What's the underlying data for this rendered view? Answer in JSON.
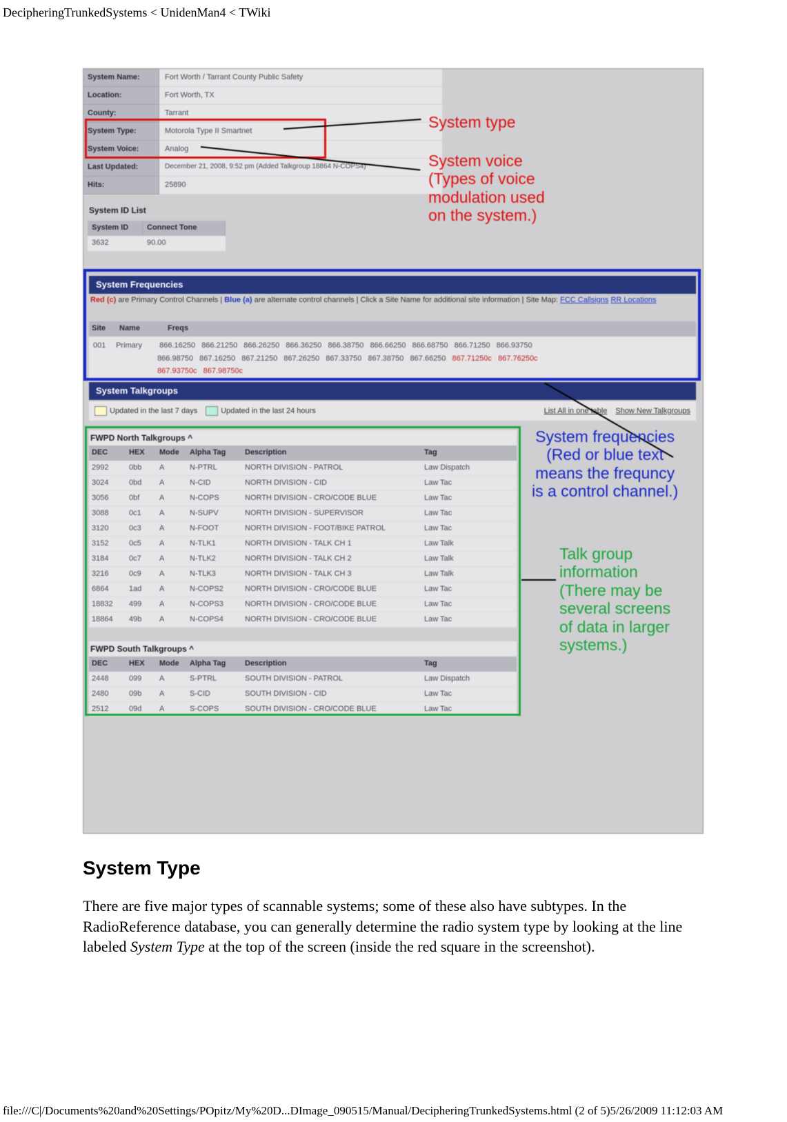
{
  "header": {
    "path": "DecipheringTrunkedSystems < UnidenMan4 < TWiki"
  },
  "info": {
    "rows": [
      {
        "label": "System Name:",
        "val": "Fort Worth / Tarrant County Public Safety"
      },
      {
        "label": "Location:",
        "val": "Fort Worth, TX"
      },
      {
        "label": "County:",
        "val": "Tarrant"
      },
      {
        "label": "System Type:",
        "val": "Motorola Type II Smartnet"
      },
      {
        "label": "System Voice:",
        "val": "Analog"
      },
      {
        "label": "Last Updated:",
        "val": "December 21, 2008, 9:52 pm (Added Talkgroup 18864 N-COPS4)"
      },
      {
        "label": "Hits:",
        "val": "25890"
      }
    ]
  },
  "sysid": {
    "title": "System ID List",
    "hdr_id": "System ID",
    "hdr_ct": "Connect Tone",
    "row_id": "3632",
    "row_ct": "90.00"
  },
  "sections": {
    "freq": "System Frequencies",
    "tg": "System Talkgroups"
  },
  "freqnote": {
    "red_label": "Red (c)",
    "text1": " are Primary Control Channels | ",
    "blue_label": "Blue (a)",
    "text2": " are alternate control channels | Click a Site Name for additional site information | Site Map: ",
    "link1": "FCC Callsigns",
    "sep": " ",
    "link2": "RR Locations"
  },
  "freqhdr": {
    "site": "Site",
    "name": "Name",
    "freqs": "Freqs"
  },
  "freqbody": {
    "site": "001",
    "name": "Primary",
    "row1": [
      "866.16250",
      "866.21250",
      "866.26250",
      "866.36250",
      "866.38750",
      "866.66250",
      "866.68750",
      "866.71250",
      "866.93750"
    ],
    "row2": [
      "866.98750",
      "867.16250",
      "867.21250",
      "867.26250",
      "867.33750",
      "867.38750",
      "867.66250"
    ],
    "row2_red": [
      "867.71250c",
      "867.76250c"
    ],
    "row3_red": [
      "867.93750c",
      "867.98750c"
    ]
  },
  "legend": {
    "item1": "Updated in the last 7 days",
    "item2": "Updated in the last 24 hours",
    "link1": "List All in one table",
    "link2": "Show New Talkgroups"
  },
  "tg_north": {
    "title": "FWPD North Talkgroups  ^",
    "hdr": {
      "dec": "DEC",
      "hex": "HEX",
      "mode": "Mode",
      "tag": "Alpha Tag",
      "desc": "Description",
      "cat": "Tag"
    },
    "rows": [
      {
        "dec": "2992",
        "hex": "0bb",
        "mode": "A",
        "tag": "N-PTRL",
        "desc": "NORTH DIVISION - PATROL",
        "cat": "Law Dispatch"
      },
      {
        "dec": "3024",
        "hex": "0bd",
        "mode": "A",
        "tag": "N-CID",
        "desc": "NORTH DIVISION - CID",
        "cat": "Law Tac"
      },
      {
        "dec": "3056",
        "hex": "0bf",
        "mode": "A",
        "tag": "N-COPS",
        "desc": "NORTH DIVISION - CRO/CODE BLUE",
        "cat": "Law Tac"
      },
      {
        "dec": "3088",
        "hex": "0c1",
        "mode": "A",
        "tag": "N-SUPV",
        "desc": "NORTH DIVISION - SUPERVISOR",
        "cat": "Law Tac"
      },
      {
        "dec": "3120",
        "hex": "0c3",
        "mode": "A",
        "tag": "N-FOOT",
        "desc": "NORTH DIVISION - FOOT/BIKE PATROL",
        "cat": "Law Tac"
      },
      {
        "dec": "3152",
        "hex": "0c5",
        "mode": "A",
        "tag": "N-TLK1",
        "desc": "NORTH DIVISION - TALK CH 1",
        "cat": "Law Talk"
      },
      {
        "dec": "3184",
        "hex": "0c7",
        "mode": "A",
        "tag": "N-TLK2",
        "desc": "NORTH DIVISION - TALK CH 2",
        "cat": "Law Talk"
      },
      {
        "dec": "3216",
        "hex": "0c9",
        "mode": "A",
        "tag": "N-TLK3",
        "desc": "NORTH DIVISION - TALK CH 3",
        "cat": "Law Talk"
      },
      {
        "dec": "6864",
        "hex": "1ad",
        "mode": "A",
        "tag": "N-COPS2",
        "desc": "NORTH DIVISION - CRO/CODE BLUE",
        "cat": "Law Tac"
      },
      {
        "dec": "18832",
        "hex": "499",
        "mode": "A",
        "tag": "N-COPS3",
        "desc": "NORTH DIVISION - CRO/CODE BLUE",
        "cat": "Law Tac"
      },
      {
        "dec": "18864",
        "hex": "49b",
        "mode": "A",
        "tag": "N-COPS4",
        "desc": "NORTH DIVISION - CRO/CODE BLUE",
        "cat": "Law Tac"
      }
    ]
  },
  "tg_south": {
    "title": "FWPD South Talkgroups  ^",
    "hdr": {
      "dec": "DEC",
      "hex": "HEX",
      "mode": "Mode",
      "tag": "Alpha Tag",
      "desc": "Description",
      "cat": "Tag"
    },
    "rows": [
      {
        "dec": "2448",
        "hex": "099",
        "mode": "A",
        "tag": "S-PTRL",
        "desc": "SOUTH DIVISION - PATROL",
        "cat": "Law Dispatch"
      },
      {
        "dec": "2480",
        "hex": "09b",
        "mode": "A",
        "tag": "S-CID",
        "desc": "SOUTH DIVISION - CID",
        "cat": "Law Tac"
      },
      {
        "dec": "2512",
        "hex": "09d",
        "mode": "A",
        "tag": "S-COPS",
        "desc": "SOUTH DIVISION - CRO/CODE BLUE",
        "cat": "Law Tac"
      }
    ]
  },
  "annotations": {
    "systype": "System type",
    "sysvoice": "System voice\n(Types of voice\nmodulation used\non the system.)",
    "sysfreq": "System frequencies\n(Red or blue text\nmeans the frequncy\nis a control channel.)",
    "tginfo": "Talk group\ninformation\n(There may be\nseveral screens\nof data in larger\nsystems.)"
  },
  "article": {
    "heading": "System Type",
    "para_a": "There are five major types of scannable systems; some of these also have subtypes. In the RadioReference database, you can generally determine the radio system type by looking at the line labeled ",
    "para_em": "System Type",
    "para_b": " at the top of the screen (inside the red square in the screenshot)."
  },
  "footer": {
    "path": "file:///C|/Documents%20and%20Settings/POpitz/My%20D...DImage_090515/Manual/DecipheringTrunkedSystems.html (2 of 5)5/26/2009 11:12:03 AM"
  }
}
